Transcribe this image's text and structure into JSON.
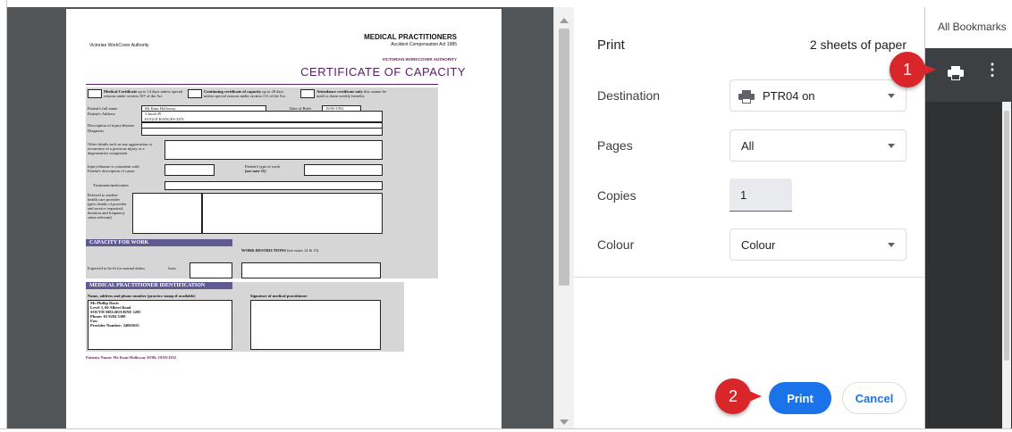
{
  "document": {
    "authority": "Victorian WorkCover Authority",
    "header_title": "MEDICAL PRACTITIONERS",
    "header_act": "Accident Compensation Act 1985",
    "header_authority": "VICTORIAN WORKCOVER AUTHORITY",
    "certificate_title": "CERTIFICATE OF CAPACITY",
    "cert_options": [
      {
        "label": "Medical Certificate",
        "note": "up to 14 days unless special reasons under section 107 of the Act"
      },
      {
        "label": "Continuing certificate of capacity",
        "note": "up to 28 days unless special reasons under section 111 of the Act"
      },
      {
        "label": "Attendance certificate only",
        "note": "this cannot be used to claim weekly benefits"
      }
    ],
    "fields": {
      "full_name_label": "Patient's full name",
      "full_name": "Mr Knut Holloway",
      "dob_label": "Date of Birth",
      "dob": "19/05/1952",
      "address_label": "Patient's Address",
      "address_line1": "5 Jacob Pl",
      "address_line2": "EUGLE RANGES 3251",
      "injury_label": "Description of injury/disease",
      "diagnosis_label": "Diagnosis",
      "aggravation_label": "Other details such as any aggravation or recurrence of a previous injury or a degenerative component",
      "consistent_label": "Injury/disease is consistent with Patient's description of cause:",
      "work_type_label": "Patient's type of work",
      "work_type_note": "(see note 11)",
      "treatment_label": "Treatment/medication",
      "referral_label": "Referral to another health care provider (give details of provider and service requested, duration and frequency when relevant)"
    },
    "capacity_band": "CAPACITY FOR WORK",
    "work_restrictions": "WORK RESTRICTIONS",
    "work_restrictions_note": "(see notes 14 & 15)",
    "fit_label": "Expected to be fit for normal duties",
    "from_label": "from",
    "practitioner_band": "MEDICAL PRACTITIONER IDENTIFICATION",
    "practitioner_label": "Name, address and phone number (practice stamp if available)",
    "signature_label": "Signature of medical practitioner",
    "practitioner": {
      "name": "Mr Phillip Davis",
      "address1": "Level 3, 60 Albert Road",
      "address2": "SOUTH MELBOURNE 3205",
      "phone": "Phone: 03 9284 3300",
      "fax": "Fax:",
      "provider": "Provider Number: 24002655"
    },
    "footer": "Patients Name: Mr Knut Holloway  DOB: 19/05/1952"
  },
  "print_panel": {
    "title": "Print",
    "sheets": "2 sheets of paper",
    "destination_label": "Destination",
    "destination_value": "PTR04 on",
    "pages_label": "Pages",
    "pages_value": "All",
    "copies_label": "Copies",
    "copies_value": "1",
    "colour_label": "Colour",
    "colour_value": "Colour",
    "print_button": "Print",
    "cancel_button": "Cancel"
  },
  "browser": {
    "bookmarks": "All Bookmarks",
    "more_glyph": "⋮"
  },
  "markers": {
    "one": "1",
    "two": "2"
  },
  "colors": {
    "accent": "#1a73e8",
    "marker": "#d9262a",
    "preview_bg": "#525659",
    "certificate_purple": "#5a1c6a"
  }
}
